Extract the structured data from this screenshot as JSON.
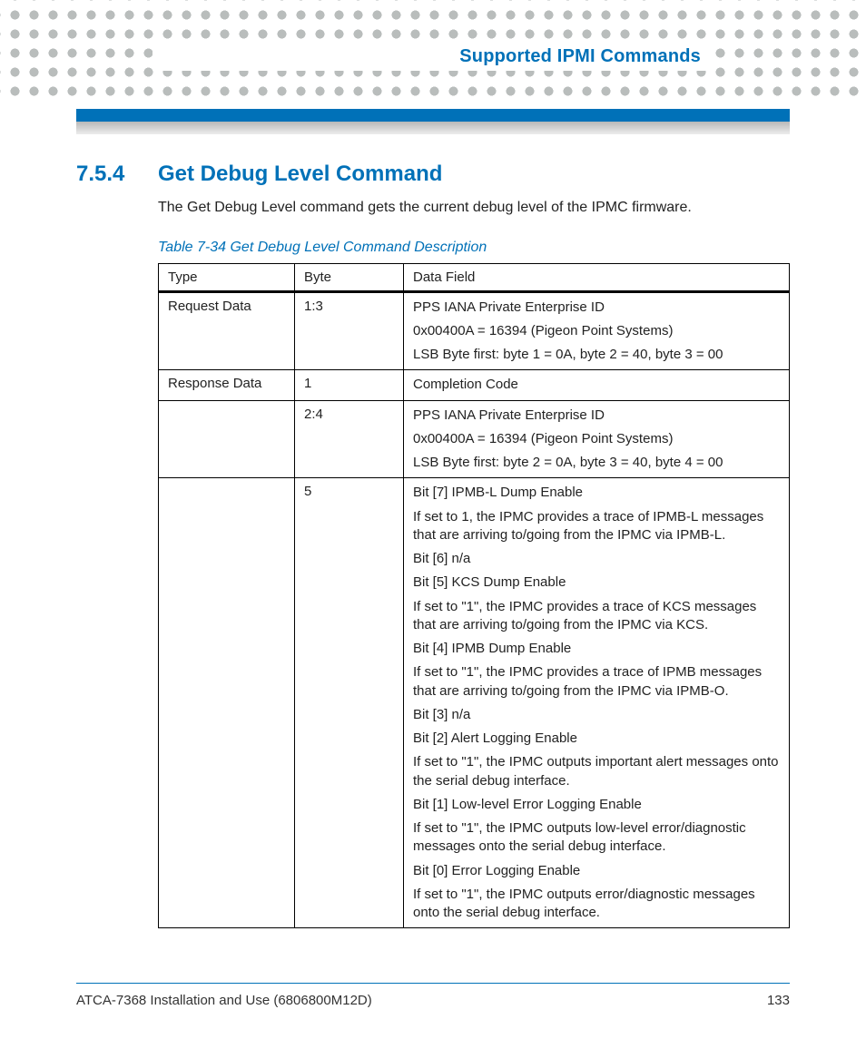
{
  "header": {
    "chapter_title": "Supported IPMI Commands"
  },
  "section": {
    "number": "7.5.4",
    "title": "Get Debug Level Command",
    "intro": "The Get Debug Level command gets the current debug level of the IPMC firmware."
  },
  "table": {
    "caption": "Table 7-34 Get Debug Level Command Description",
    "headers": {
      "c0": "Type",
      "c1": "Byte",
      "c2": "Data Field"
    },
    "rows": [
      {
        "type": "Request Data",
        "byte": "1:3",
        "data": [
          "PPS IANA Private Enterprise ID",
          "0x00400A = 16394 (Pigeon Point Systems)",
          "LSB Byte first: byte 1 = 0A, byte 2 = 40, byte 3 = 00"
        ]
      },
      {
        "type": "Response Data",
        "byte": "1",
        "data": [
          "Completion Code"
        ]
      },
      {
        "type": "",
        "byte": "2:4",
        "data": [
          "PPS IANA Private Enterprise ID",
          "0x00400A = 16394 (Pigeon Point Systems)",
          "LSB Byte first: byte 2 = 0A, byte 3 = 40, byte 4 = 00"
        ]
      },
      {
        "type": "",
        "byte": "5",
        "data": [
          "Bit [7] IPMB-L Dump Enable",
          "If set to 1, the IPMC provides a trace of IPMB-L messages that are arriving to/going from the IPMC via IPMB-L.",
          "Bit [6] n/a",
          "Bit [5] KCS Dump Enable",
          "If set to  \"1\", the IPMC provides a trace of KCS messages that are arriving to/going from the IPMC via KCS.",
          "Bit [4] IPMB Dump Enable",
          "If set to \"1\", the IPMC provides a trace of IPMB messages that are arriving to/going from the IPMC via IPMB-O.",
          "Bit [3] n/a",
          "Bit [2] Alert Logging Enable",
          "If set to  \"1\", the IPMC outputs important alert messages onto the serial debug interface.",
          "Bit [1] Low-level Error Logging Enable",
          "If set to \"1\", the IPMC outputs low-level error/diagnostic messages onto the serial debug interface.",
          "Bit [0] Error Logging Enable",
          "If set to \"1\", the IPMC outputs error/diagnostic messages onto the serial debug interface."
        ]
      }
    ]
  },
  "footer": {
    "doc_title": "ATCA-7368 Installation and Use (6806800M12D)",
    "page": "133"
  }
}
